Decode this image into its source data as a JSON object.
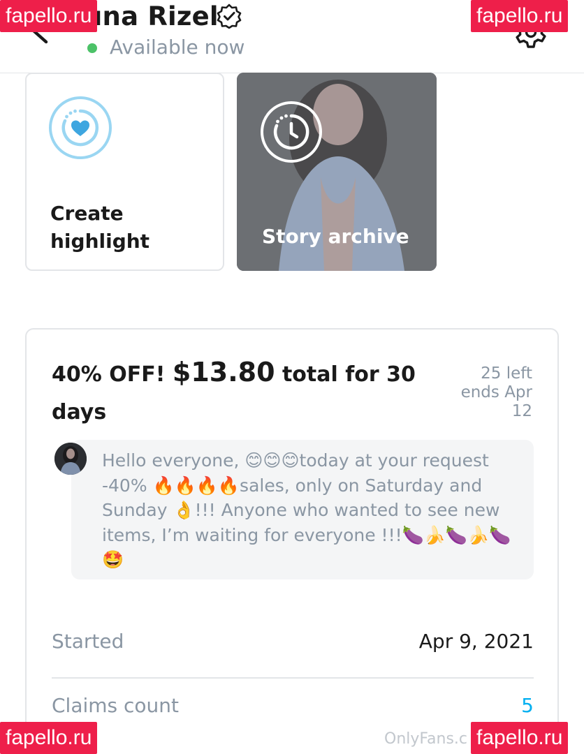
{
  "header": {
    "profile_name": "una Rizel",
    "status_text": "Available now"
  },
  "highlights": {
    "create_label": "Create highlight",
    "archive_label": "Story archive"
  },
  "promo": {
    "title_prefix": "40% OFF! ",
    "price": "$13.80",
    "title_suffix": " total for 30 days",
    "left_count": "25 left",
    "ends_text": "ends Apr 12",
    "message": "Hello everyone, 😊😊😊today at your request -40% 🔥🔥🔥🔥sales, only on Saturday and Sunday 👌!!! Anyone who wanted to see new items, I’m waiting for everyone !!!🍆🍌🍆🍌🍆🤩",
    "started_label": "Started",
    "started_value": "Apr 9, 2021",
    "claims_label": "Claims count",
    "claims_value": "5"
  },
  "footer": {
    "url_text": "OnlyFans.c"
  },
  "watermarks": {
    "text": "fapello.ru"
  },
  "colors": {
    "accent": "#00aff0",
    "online": "#4cc268",
    "muted_text": "#8a96a3",
    "watermark_bg": "#ee1f4a"
  }
}
